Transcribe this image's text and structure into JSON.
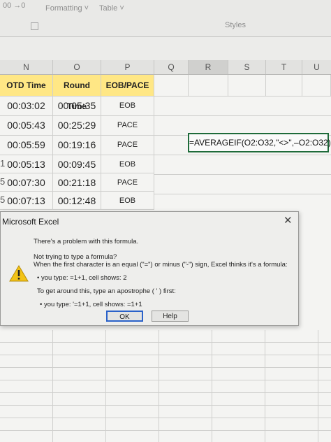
{
  "ribbon": {
    "formatting_label": "Formatting ˅",
    "table_label": "Table ˅",
    "styles_label": "Styles",
    "corner_text": "00 →0"
  },
  "columns": [
    "N",
    "O",
    "P",
    "Q",
    "R",
    "S",
    "T",
    "U"
  ],
  "table": {
    "headers": [
      "OTD Time",
      "Round Time",
      "EOB/PACE"
    ],
    "rows": [
      {
        "otd": "00:03:02",
        "round": "00:05:35",
        "type": "EOB"
      },
      {
        "otd": "00:05:43",
        "round": "00:25:29",
        "type": "PACE"
      },
      {
        "otd": "00:05:59",
        "round": "00:19:16",
        "type": "PACE"
      },
      {
        "otd": "00:05:13",
        "round": "00:09:45",
        "type": "EOB"
      },
      {
        "otd": "00:07:30",
        "round": "00:21:18",
        "type": "PACE"
      },
      {
        "otd": "00:07:13",
        "round": "00:12:48",
        "type": "EOB"
      }
    ],
    "row_fragments": [
      "1",
      "5",
      "5"
    ]
  },
  "formula_cell": "=AVERAGEIF(O2:O32,\"<>\",–O2:O32)",
  "dialog": {
    "title": "Microsoft Excel",
    "close": "✕",
    "line1": "There's a problem with this formula.",
    "line2": "Not trying to type a formula?",
    "line3": "When the first character is an equal (\"=\") or minus (\"-\") sign, Excel thinks it's a formula:",
    "line4": "• you type:   =1+1, cell shows:   2",
    "line5": "To get around this, type an apostrophe ( ' ) first:",
    "line6": "• you type:   '=1+1, cell shows:   =1+1",
    "ok_label": "OK",
    "help_label": "Help",
    "warning_icon": "warning-icon"
  }
}
